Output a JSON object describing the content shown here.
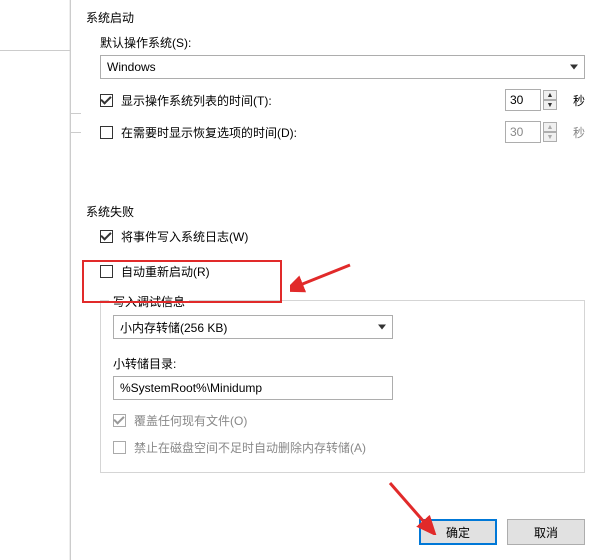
{
  "startup": {
    "section_title": "系统启动",
    "default_os_label": "默认操作系统(S):",
    "default_os_value": "Windows",
    "show_list_label": "显示操作系统列表的时间(T):",
    "show_list_checked": true,
    "show_list_value": "30",
    "show_recovery_label": "在需要时显示恢复选项的时间(D):",
    "show_recovery_checked": false,
    "show_recovery_value": "30",
    "seconds": "秒"
  },
  "failure": {
    "section_title": "系统失败",
    "write_log_label": "将事件写入系统日志(W)",
    "write_log_checked": true,
    "auto_restart_label": "自动重新启动(R)",
    "auto_restart_checked": false,
    "debug_group_title": "写入调试信息",
    "debug_type_value": "小内存转储(256 KB)",
    "dump_dir_label": "小转储目录:",
    "dump_dir_value": "%SystemRoot%\\Minidump",
    "overwrite_label": "覆盖任何现有文件(O)",
    "overwrite_checked": true,
    "no_delete_label": "禁止在磁盘空间不足时自动删除内存转储(A)",
    "no_delete_checked": false
  },
  "buttons": {
    "ok": "确定",
    "cancel": "取消"
  }
}
